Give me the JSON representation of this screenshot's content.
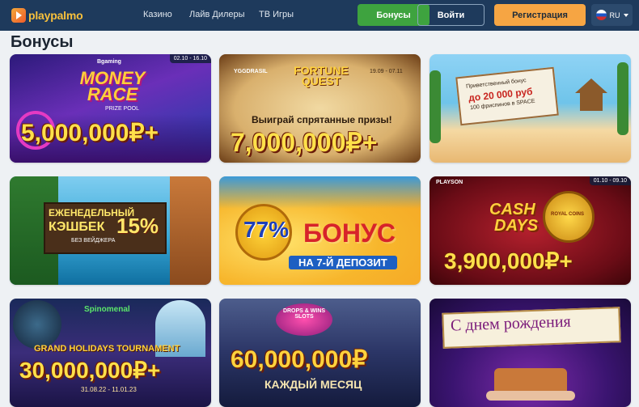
{
  "header": {
    "logo_text": "playpalmo",
    "nav": [
      "Казино",
      "Лайв Дилеры",
      "ТВ Игры"
    ],
    "bonus_button": "Бонусы",
    "login_button": "Войти",
    "register_button": "Регистрация",
    "language": "RU"
  },
  "page_title": "Бонусы",
  "cards": [
    {
      "provider": "Bgaming",
      "date": "02.10 - 16.10",
      "title": "MONEY RACE",
      "subtitle": "PRIZE POOL",
      "amount": "5,000,000₽+"
    },
    {
      "provider": "YGGDRASIL",
      "date": "19.09 - 07.11",
      "title": "FORTUNE QUEST",
      "subtitle": "Выиграй спрятанные призы!",
      "amount": "7,000,000₽+"
    },
    {
      "banner_line1": "Приветственный бонус",
      "banner_line2": "до 20 000 руб",
      "banner_line3": "100 фриспинов в SPACE"
    },
    {
      "title_line1": "ЕЖЕНЕДЕЛЬНЫЙ",
      "title_line2": "КЭШБЕК",
      "percent": "15%",
      "subtitle": "БЕЗ ВЕЙДЖЕРА"
    },
    {
      "percent": "77%",
      "title": "БОНУС",
      "subtitle": "НА 7-Й ДЕПОЗИТ"
    },
    {
      "provider": "PLAYSON",
      "date": "01.10 - 09.10",
      "title_line1": "CASH",
      "title_line2": "DAYS",
      "badge": "ROYAL COINS",
      "amount": "3,900,000₽+"
    },
    {
      "provider": "Spinomenal",
      "title": "GRAND HOLIDAYS TOURNAMENT",
      "amount": "30,000,000₽+",
      "dates": "31.08.22 - 11.01.23"
    },
    {
      "badge": "DROPS & WINS SLOTS",
      "amount": "60,000,000₽",
      "subtitle": "КАЖДЫЙ МЕСЯЦ"
    },
    {
      "title": "С днем рождения"
    }
  ]
}
